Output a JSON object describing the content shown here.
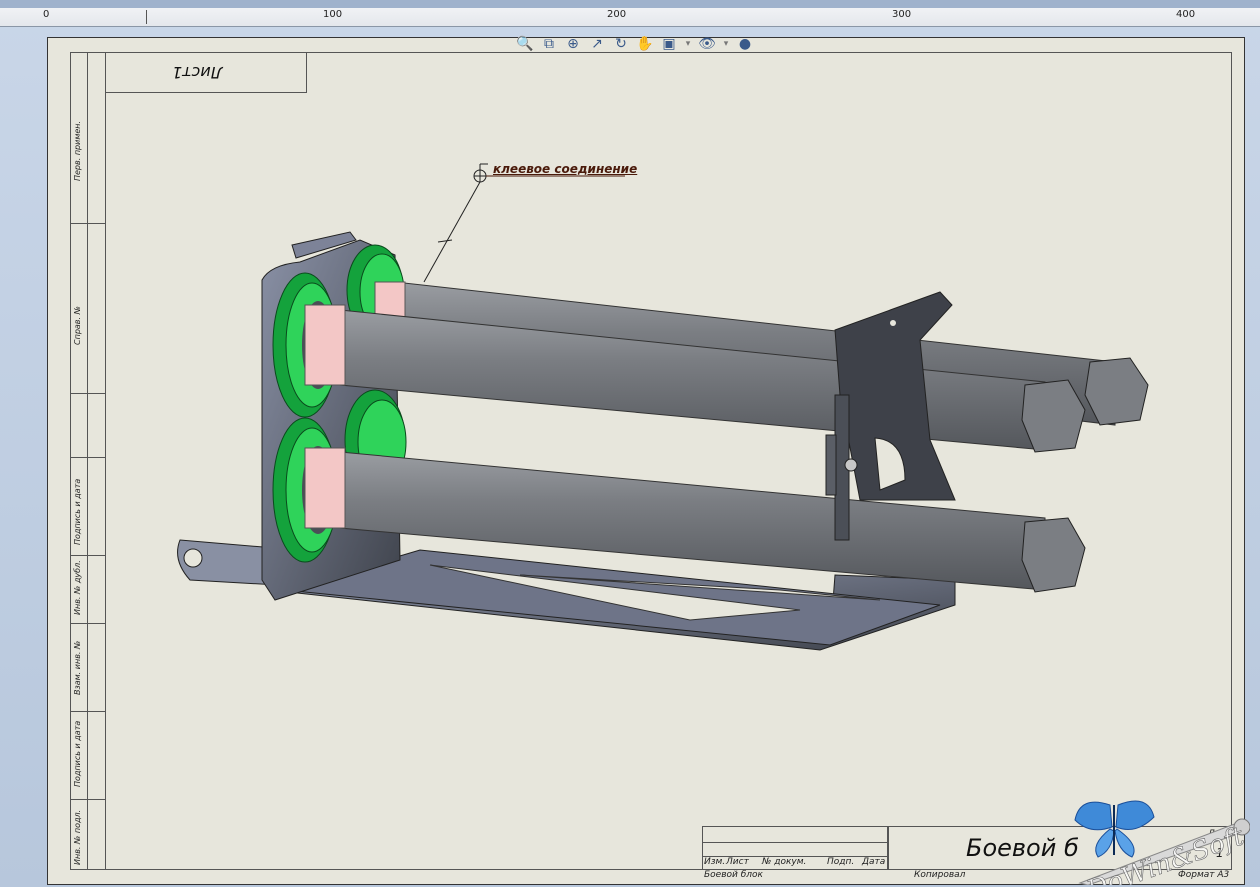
{
  "ruler": {
    "marks": [
      "0",
      "100",
      "200",
      "300",
      "400"
    ]
  },
  "toolbar": {
    "icons": [
      "zoom-to-fit-icon",
      "zoom-area-icon",
      "zoom-in-out-icon",
      "select-icon",
      "rotate-icon",
      "pan-icon",
      "display-style-icon",
      "visibility-icon",
      "appearance-icon"
    ]
  },
  "sheet": {
    "sheet_name_rotated": "Лист1"
  },
  "left_strip": {
    "labels": [
      "Перв. примен.",
      "Справ. №",
      "Подпись и дата",
      "Инв. № дубл.",
      "Взам. инв. №",
      "Подпись и дата",
      "Инв. № подл."
    ]
  },
  "callout": {
    "text": "клеевое соединение"
  },
  "title_block": {
    "col_headers": [
      "Изм.",
      "Лист",
      "№ докум.",
      "Подп.",
      "Дата"
    ],
    "designation": "Боевой блок",
    "name_partial": "Боевой  б",
    "sheet_label": "Лист",
    "sheet_number": "1",
    "copied": "Копировал",
    "format": "Формат А3"
  },
  "watermark": {
    "text": "DoWin&Soft"
  },
  "colors": {
    "sheet": "#e7e6dc",
    "tube": "#6f7277",
    "ring": "#2fd35a",
    "collar": "#f3c7c6",
    "plate": "#4b4f57"
  }
}
